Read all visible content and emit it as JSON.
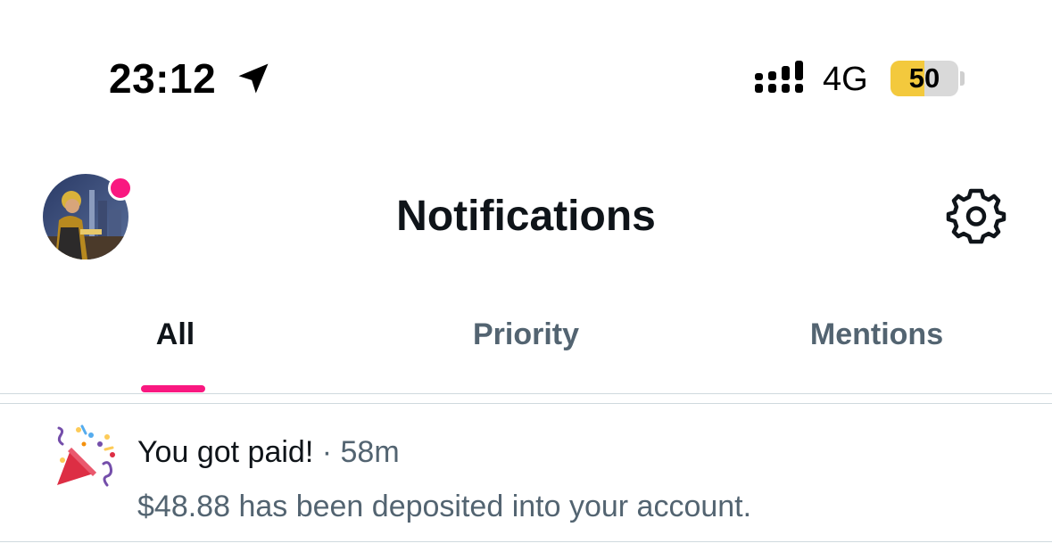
{
  "status_bar": {
    "time": "23:12",
    "network": "4G",
    "battery_level": "50",
    "battery_fraction": 0.5,
    "icons": [
      "location-arrow-icon",
      "signal-icon",
      "battery-icon"
    ]
  },
  "header": {
    "title": "Notifications",
    "avatar_has_badge": true,
    "settings_icon": "gear-icon"
  },
  "tabs": [
    {
      "label": "All",
      "active": true
    },
    {
      "label": "Priority",
      "active": false
    },
    {
      "label": "Mentions",
      "active": false
    }
  ],
  "notifications": [
    {
      "icon": "party-popper-icon",
      "title": "You got paid!",
      "time": "58m",
      "separator": "·",
      "body": "$48.88 has been deposited into your account."
    }
  ],
  "colors": {
    "accent": "#f91880",
    "text_primary": "#0f1419",
    "text_secondary": "#536471",
    "divider": "#cfd9de",
    "battery_fill": "#f3c93d"
  }
}
